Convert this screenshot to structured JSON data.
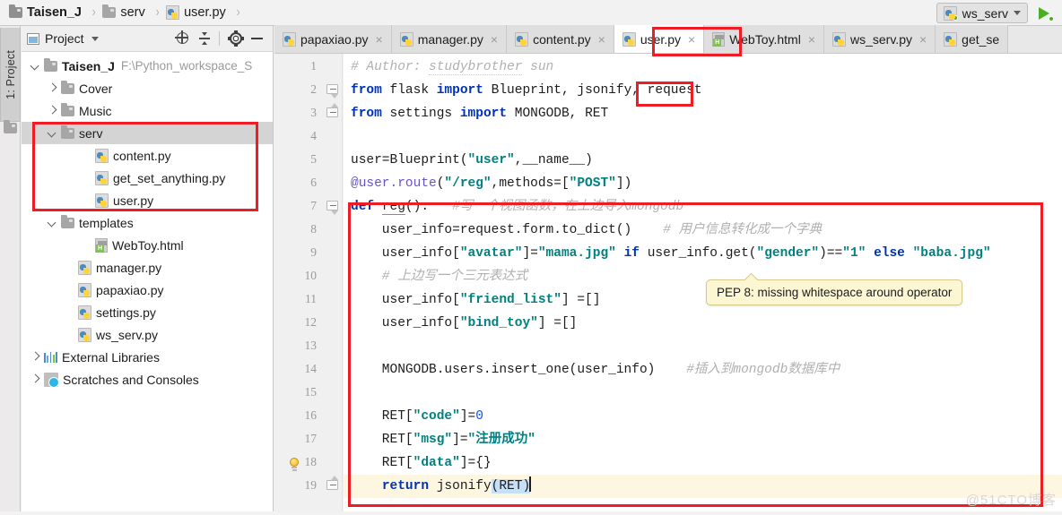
{
  "breadcrumb": {
    "items": [
      {
        "label": "Taisen_J",
        "icon": "folder-icon",
        "bold": true
      },
      {
        "label": "serv",
        "icon": "folder-icon",
        "bold": false
      },
      {
        "label": "user.py",
        "icon": "python-file-icon",
        "bold": false
      }
    ],
    "separator": "›"
  },
  "toolbar": {
    "run_config": "ws_serv",
    "run_button": "run-icon",
    "dropdown_caret": "chevron-down-icon"
  },
  "tool_strip": {
    "project_tab": "1: Project"
  },
  "project_panel": {
    "title": "Project",
    "caret": "▾",
    "actions": [
      "locate-icon",
      "collapse-all-icon",
      "settings-icon",
      "hide-icon"
    ],
    "tree": [
      {
        "label": "Taisen_J",
        "path": "F:\\Python_workspace_S",
        "icon": "folder-icon",
        "twisty": "down",
        "indent": 0,
        "bold": true,
        "selected": false
      },
      {
        "label": "Cover",
        "path": "",
        "icon": "folder-icon",
        "twisty": "right",
        "indent": 1,
        "bold": false,
        "selected": false
      },
      {
        "label": "Music",
        "path": "",
        "icon": "folder-icon",
        "twisty": "right",
        "indent": 1,
        "bold": false,
        "selected": false
      },
      {
        "label": "serv",
        "path": "",
        "icon": "folder-icon",
        "twisty": "down",
        "indent": 1,
        "bold": false,
        "selected": true
      },
      {
        "label": "content.py",
        "path": "",
        "icon": "python-file-icon",
        "twisty": "none",
        "indent": 3,
        "bold": false,
        "selected": false
      },
      {
        "label": "get_set_anything.py",
        "path": "",
        "icon": "python-file-icon",
        "twisty": "none",
        "indent": 3,
        "bold": false,
        "selected": false
      },
      {
        "label": "user.py",
        "path": "",
        "icon": "python-file-icon",
        "twisty": "none",
        "indent": 3,
        "bold": false,
        "selected": false
      },
      {
        "label": "templates",
        "path": "",
        "icon": "folder-icon",
        "twisty": "down",
        "indent": 1,
        "bold": false,
        "selected": false
      },
      {
        "label": "WebToy.html",
        "path": "",
        "icon": "html-file-icon",
        "twisty": "none",
        "indent": 3,
        "bold": false,
        "selected": false
      },
      {
        "label": "manager.py",
        "path": "",
        "icon": "python-file-icon",
        "twisty": "none",
        "indent": 2,
        "bold": false,
        "selected": false
      },
      {
        "label": "papaxiao.py",
        "path": "",
        "icon": "python-file-icon",
        "twisty": "none",
        "indent": 2,
        "bold": false,
        "selected": false
      },
      {
        "label": "settings.py",
        "path": "",
        "icon": "python-file-icon",
        "twisty": "none",
        "indent": 2,
        "bold": false,
        "selected": false
      },
      {
        "label": "ws_serv.py",
        "path": "",
        "icon": "python-file-icon",
        "twisty": "none",
        "indent": 2,
        "bold": false,
        "selected": false
      },
      {
        "label": "External Libraries",
        "path": "",
        "icon": "libraries-icon",
        "twisty": "right",
        "indent": 0,
        "bold": false,
        "selected": false
      },
      {
        "label": "Scratches and Consoles",
        "path": "",
        "icon": "scratches-icon",
        "twisty": "right",
        "indent": 0,
        "bold": false,
        "selected": false
      }
    ]
  },
  "editor_tabs": [
    {
      "label": "papaxiao.py",
      "icon": "python-file-icon",
      "active": false,
      "close": "×"
    },
    {
      "label": "manager.py",
      "icon": "python-file-icon",
      "active": false,
      "close": "×"
    },
    {
      "label": "content.py",
      "icon": "python-file-icon",
      "active": false,
      "close": "×"
    },
    {
      "label": "user.py",
      "icon": "python-file-icon",
      "active": true,
      "close": "×"
    },
    {
      "label": "WebToy.html",
      "icon": "html-file-icon",
      "active": false,
      "close": "×"
    },
    {
      "label": "ws_serv.py",
      "icon": "python-file-icon",
      "active": false,
      "close": "×"
    },
    {
      "label": "get_se",
      "icon": "python-file-icon",
      "active": false,
      "close": ""
    }
  ],
  "editor": {
    "line_numbers": [
      "1",
      "2",
      "3",
      "4",
      "5",
      "6",
      "7",
      "8",
      "9",
      "10",
      "11",
      "12",
      "13",
      "14",
      "15",
      "16",
      "17",
      "18",
      "19"
    ],
    "current_line": 19,
    "lines": [
      {
        "n": 1,
        "segments": [
          {
            "t": "# Author: ",
            "c": "cmt"
          },
          {
            "t": "studybrother",
            "c": "cmt wavy"
          },
          {
            "t": " sun",
            "c": "cmt"
          }
        ]
      },
      {
        "n": 2,
        "segments": [
          {
            "t": "from ",
            "c": "kw"
          },
          {
            "t": "flask ",
            "c": ""
          },
          {
            "t": "import ",
            "c": "kw"
          },
          {
            "t": "Blueprint, jsonify, request",
            "c": ""
          }
        ]
      },
      {
        "n": 3,
        "segments": [
          {
            "t": "from ",
            "c": "kw"
          },
          {
            "t": "settings ",
            "c": ""
          },
          {
            "t": "import ",
            "c": "kw"
          },
          {
            "t": "MONGODB, RET",
            "c": ""
          }
        ]
      },
      {
        "n": 4,
        "segments": []
      },
      {
        "n": 5,
        "segments": [
          {
            "t": "user=Blueprint(",
            "c": ""
          },
          {
            "t": "″user″",
            "c": "str"
          },
          {
            "t": ",__name__)",
            "c": ""
          }
        ]
      },
      {
        "n": 6,
        "segments": [
          {
            "t": "@user.route",
            "c": "dec"
          },
          {
            "t": "(",
            "c": ""
          },
          {
            "t": "″/reg″",
            "c": "str"
          },
          {
            "t": ",methods=[",
            "c": ""
          },
          {
            "t": "″POST″",
            "c": "str"
          },
          {
            "t": "])",
            "c": ""
          }
        ]
      },
      {
        "n": 7,
        "segments": [
          {
            "t": "def ",
            "c": "kw"
          },
          {
            "t": "reg",
            "c": "fn"
          },
          {
            "t": "():   ",
            "c": ""
          },
          {
            "t": "#写一个视图函数，在上边导入mongodb",
            "c": "cmt"
          }
        ]
      },
      {
        "n": 8,
        "segments": [
          {
            "t": "    user_info=request.form.to_dict()    ",
            "c": ""
          },
          {
            "t": "# 用户信息转化成一个字典",
            "c": "cmt"
          }
        ]
      },
      {
        "n": 9,
        "segments": [
          {
            "t": "    user_info[",
            "c": ""
          },
          {
            "t": "″avatar″",
            "c": "str"
          },
          {
            "t": "]=",
            "c": ""
          },
          {
            "t": "″mama.jpg″",
            "c": "str"
          },
          {
            "t": " ",
            "c": ""
          },
          {
            "t": "if ",
            "c": "kw"
          },
          {
            "t": "user_info.get(",
            "c": ""
          },
          {
            "t": "″gender″",
            "c": "str"
          },
          {
            "t": ")==",
            "c": ""
          },
          {
            "t": "″1″",
            "c": "str"
          },
          {
            "t": " ",
            "c": ""
          },
          {
            "t": "else ",
            "c": "kw"
          },
          {
            "t": "″baba.jpg″",
            "c": "str"
          }
        ]
      },
      {
        "n": 10,
        "segments": [
          {
            "t": "    # 上边写一个三元表达式",
            "c": "cmt"
          }
        ]
      },
      {
        "n": 11,
        "segments": [
          {
            "t": "    user_info[",
            "c": ""
          },
          {
            "t": "″friend_list″",
            "c": "str"
          },
          {
            "t": "] =[]",
            "c": ""
          }
        ]
      },
      {
        "n": 12,
        "segments": [
          {
            "t": "    user_info[",
            "c": ""
          },
          {
            "t": "″bind_toy″",
            "c": "str"
          },
          {
            "t": "] =[]",
            "c": ""
          }
        ]
      },
      {
        "n": 13,
        "segments": []
      },
      {
        "n": 14,
        "segments": [
          {
            "t": "    MONGODB.users.insert_one(user_info)    ",
            "c": ""
          },
          {
            "t": "#插入到mongodb数据库中",
            "c": "cmt"
          }
        ]
      },
      {
        "n": 15,
        "segments": []
      },
      {
        "n": 16,
        "segments": [
          {
            "t": "    RET[",
            "c": ""
          },
          {
            "t": "″code″",
            "c": "str"
          },
          {
            "t": "]=",
            "c": ""
          },
          {
            "t": "0",
            "c": "num"
          }
        ]
      },
      {
        "n": 17,
        "segments": [
          {
            "t": "    RET[",
            "c": ""
          },
          {
            "t": "″msg″",
            "c": "str"
          },
          {
            "t": "]=",
            "c": ""
          },
          {
            "t": "″注册成功″",
            "c": "str"
          }
        ]
      },
      {
        "n": 18,
        "segments": [
          {
            "t": "    RET[",
            "c": ""
          },
          {
            "t": "″data″",
            "c": "str"
          },
          {
            "t": "]={}",
            "c": ""
          }
        ]
      },
      {
        "n": 19,
        "segments": [
          {
            "t": "    ",
            "c": ""
          },
          {
            "t": "return ",
            "c": "kw"
          },
          {
            "t": "jsonify",
            "c": ""
          },
          {
            "t": "(RET)",
            "c": "sel"
          }
        ]
      }
    ]
  },
  "tooltip": {
    "text": "PEP 8: missing whitespace around operator"
  },
  "annotations": {
    "highlight_color": "#ee1c25",
    "boxes": [
      "serv-folder-group",
      "request-import",
      "code-body-block",
      "active-tab-user-py"
    ]
  },
  "watermark": "@51CTO博客"
}
